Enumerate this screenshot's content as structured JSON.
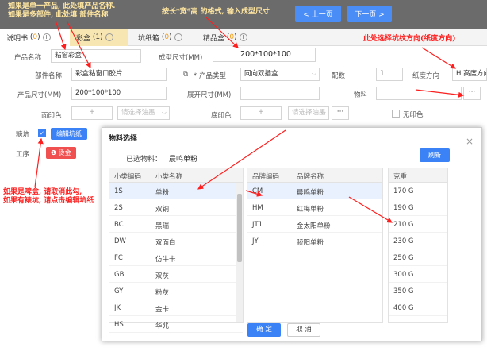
{
  "annotations": {
    "top_left_line1": "如果是单一产品, 此处填产品名称.",
    "top_left_line2": "如果是多部件, 此处填 部件名称",
    "size_hint": "按长*宽*高 的格式, 输入成型尺寸",
    "grain_hint": "此处选择坑纹方向(纸度方向)",
    "pit_hint_line1": "如果是啤盒, 请取消此勾,",
    "pit_hint_line2": "如果有裱坑, 请点击编辑坑纸"
  },
  "nav": {
    "prev": "< 上一页",
    "next": "下一页 >"
  },
  "tabs": [
    {
      "label": "说明书",
      "count": "0"
    },
    {
      "label": "彩盒",
      "count": "1"
    },
    {
      "label": "坑纸箱",
      "count": "0"
    },
    {
      "label": "精品盒",
      "count": "0"
    }
  ],
  "form": {
    "product_name_label": "产品名称",
    "product_name_value": "粘窗彩盒",
    "formed_size_label": "成型尺寸(MM)",
    "formed_size_value": "200*100*100",
    "part_name_label": "部件名称",
    "part_name_value": "彩盒粘窗口胶片",
    "product_type_label": "* 产品类型",
    "product_type_value": "同向双插盒",
    "match_count_label": "配数",
    "match_count_value": "1",
    "grain_label": "纸度方向",
    "grain_value": "H 高度方向",
    "product_size_label": "产品尺寸(MM)",
    "product_size_value": "200*100*100",
    "unfold_size_label": "展开尺寸(MM)",
    "unfold_size_value": "",
    "material_label": "物料",
    "material_value": "",
    "dots": "···",
    "face_color_label": "面印色",
    "face_plus": "+",
    "face_ink_placeholder": "请选择油墨",
    "bottom_color_label": "底印色",
    "bottom_plus": "+",
    "bottom_ink_placeholder": "请选择油墨",
    "no_print_label": "无印色",
    "pit_label": "糖坑",
    "edit_pit_button": "编辑坑纸",
    "process_label": "工序",
    "process_tag": "烫金"
  },
  "dialog": {
    "title": "物料选择",
    "selected_label": "已选物料：",
    "selected_value": "晨鸣单粉",
    "refresh": "刷新",
    "close": "×",
    "cat_headers": [
      "小类编码",
      "小类名称"
    ],
    "categories": [
      [
        "1S",
        "单粉"
      ],
      [
        "2S",
        "双铜"
      ],
      [
        "BC",
        "黑瑞"
      ],
      [
        "DW",
        "双面白"
      ],
      [
        "FC",
        "仿牛卡"
      ],
      [
        "GB",
        "双灰"
      ],
      [
        "GY",
        "粉灰"
      ],
      [
        "JK",
        "金卡"
      ],
      [
        "HS",
        "华兆"
      ]
    ],
    "brand_headers": [
      "品牌编码",
      "品牌名称"
    ],
    "brands": [
      [
        "CM",
        "晨鸣单粉"
      ],
      [
        "HM",
        "红梅单粉"
      ],
      [
        "JT1",
        "金太阳单粉"
      ],
      [
        "JY",
        "骄阳单粉"
      ]
    ],
    "weight_header": "克重",
    "weights": [
      "170 G",
      "190 G",
      "210 G",
      "230 G",
      "250 G",
      "300 G",
      "350 G",
      "400 G"
    ],
    "ok": "确 定",
    "cancel": "取 消"
  }
}
